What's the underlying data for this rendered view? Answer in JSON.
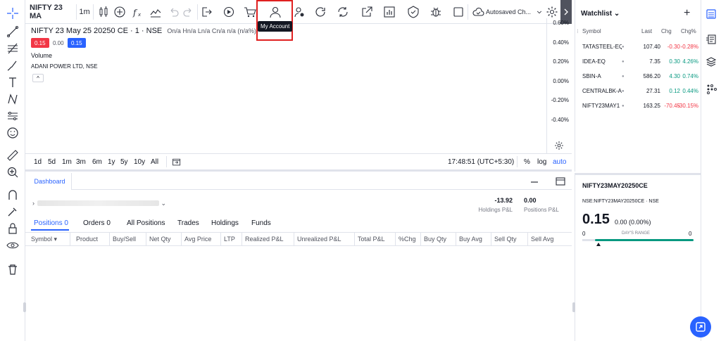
{
  "toolbar": {
    "symbol": "NIFTY 23 MA",
    "interval": "1m",
    "tooltip": "My Account",
    "layout_label": "Autosaved Ch..."
  },
  "chart": {
    "legend_title": "NIFTY 23 May 25 20250 CE · 1 · NSE",
    "legend_ohlc": "On/a Hn/a Ln/a Cn/a n/a (n/a%)",
    "badge_left": "0.15",
    "badge_mid": "0.00",
    "badge_right": "0.15",
    "volume_label": "Volume",
    "indicator_label": "ADANI POWER LTD, NSE",
    "collapse_glyph": "^",
    "axis_labels": [
      "0.60%",
      "0.40%",
      "0.20%",
      "0.00%",
      "-0.20%",
      "-0.40%"
    ]
  },
  "range_bar": {
    "ranges": [
      "1d",
      "5d",
      "1m",
      "3m",
      "6m",
      "1y",
      "5y",
      "10y",
      "All"
    ],
    "time": "17:48:51 (UTC+5:30)",
    "percent": "%",
    "log": "log",
    "auto": "auto"
  },
  "panel": {
    "tab": "Dashboard",
    "account_prefix": "›",
    "holdings_pl_value": "-13.92",
    "holdings_pl_label": "Holdings P&L",
    "positions_pl_value": "0.00",
    "positions_pl_label": "Positions P&L",
    "tabs": [
      "Positions  0",
      "Orders  0",
      "All Positions",
      "Trades",
      "Holdings",
      "Funds"
    ],
    "columns": [
      "Symbol ▾",
      "Product",
      "Buy/Sell",
      "Net Qty",
      "Avg Price",
      "LTP",
      "Realized P&L",
      "Unrealized P&L",
      "Total P&L",
      "%Chg",
      "Buy Qty",
      "Buy Avg",
      "Sell Qty",
      "Sell Avg"
    ]
  },
  "watchlist": {
    "title": "Watchlist ⌄",
    "add": "+",
    "headers": {
      "symbol": "Symbol",
      "last": "Last",
      "chg": "Chg",
      "chgp": "Chg%"
    },
    "rows": [
      {
        "symbol": "TATASTEEL-EQ",
        "last": "107.40",
        "chg": "-0.30",
        "chgp": "-0.28%",
        "dir": "down"
      },
      {
        "symbol": "IDEA-EQ",
        "last": "7.35",
        "chg": "0.30",
        "chgp": "4.26%",
        "dir": "up"
      },
      {
        "symbol": "SBIN-A",
        "last": "586.20",
        "chg": "4.30",
        "chgp": "0.74%",
        "dir": "up"
      },
      {
        "symbol": "CENTRALBK-A",
        "last": "27.31",
        "chg": "0.12",
        "chgp": "0.44%",
        "dir": "up"
      },
      {
        "symbol": "NIFTY23MAY1",
        "last": "163.25",
        "chg": "-70.45",
        "chgp": "-30.15%",
        "dir": "down"
      }
    ]
  },
  "details": {
    "title": "NIFTY23MAY20250CE",
    "subtitle": "NSE:NIFTY23MAY20250CE · NSE",
    "price": "0.15",
    "change": "0.00 (0.00%)",
    "range_low": "0",
    "range_high": "0",
    "range_label": "DAY'S RANGE"
  },
  "colors": {
    "accent": "#2962ff",
    "up": "#089981",
    "down": "#f23645",
    "highlight": "#e02020"
  }
}
